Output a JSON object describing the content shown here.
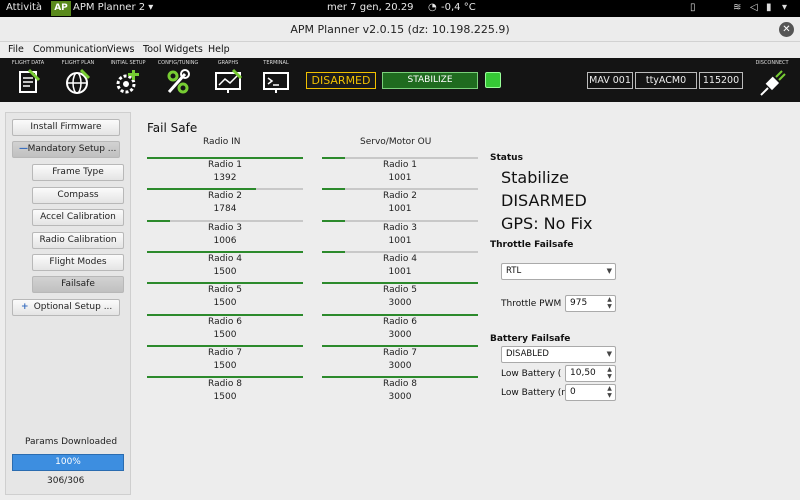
{
  "topbar": {
    "activities": "Attività",
    "app_icon_text": "AP",
    "app_name": "APM Planner 2 ▾",
    "clock": "mer  7 gen, 20.29",
    "weather": "-0,4 °C"
  },
  "window": {
    "title": "APM Planner v2.0.15 (dz: 10.198.225.9)",
    "close": "✕"
  },
  "menu": [
    "File",
    "Communication",
    "Views",
    "Tool Widgets",
    "Help"
  ],
  "toolbar": {
    "tools": [
      "FLIGHT DATA",
      "FLIGHT PLAN",
      "INITIAL SETUP",
      "CONFIG/TUNING",
      "GRAPHS",
      "TERMINAL"
    ],
    "arm_state": "DISARMED",
    "flight_mode": "STABILIZE",
    "mav": "MAV 001",
    "port": "ttyACM0",
    "baud": "115200",
    "disconnect": "DISCONNECT"
  },
  "sidebar": {
    "install_firmware": "Install Firmware",
    "mandatory_setup": "Mandatory Setup ...",
    "items": [
      "Frame Type",
      "Compass",
      "Accel Calibration",
      "Radio Calibration",
      "Flight Modes",
      "Failsafe"
    ],
    "optional_setup": "Optional Setup ...",
    "params_label": "Params Downloaded",
    "progress_text": "100%",
    "progress_fraction": 1.0,
    "params_count": "306/306"
  },
  "failsafe": {
    "title": "Fail Safe",
    "radio_header": "Radio IN",
    "servo_header": "Servo/Motor OU",
    "radio": [
      {
        "name": "Radio 1",
        "value": "1392",
        "fill": 1.0
      },
      {
        "name": "Radio 2",
        "value": "1784",
        "fill": 0.7
      },
      {
        "name": "Radio 3",
        "value": "1006",
        "fill": 0.15
      },
      {
        "name": "Radio 4",
        "value": "1500",
        "fill": 1.0
      },
      {
        "name": "Radio 5",
        "value": "1500",
        "fill": 1.0
      },
      {
        "name": "Radio 6",
        "value": "1500",
        "fill": 1.0
      },
      {
        "name": "Radio 7",
        "value": "1500",
        "fill": 1.0
      },
      {
        "name": "Radio 8",
        "value": "1500",
        "fill": 1.0
      }
    ],
    "servo": [
      {
        "name": "Radio 1",
        "value": "1001",
        "fill": 0.15
      },
      {
        "name": "Radio 2",
        "value": "1001",
        "fill": 0.15
      },
      {
        "name": "Radio 3",
        "value": "1001",
        "fill": 0.15
      },
      {
        "name": "Radio 4",
        "value": "1001",
        "fill": 0.15
      },
      {
        "name": "Radio 5",
        "value": "3000",
        "fill": 1.0
      },
      {
        "name": "Radio 6",
        "value": "3000",
        "fill": 1.0
      },
      {
        "name": "Radio 7",
        "value": "3000",
        "fill": 1.0
      },
      {
        "name": "Radio 8",
        "value": "3000",
        "fill": 1.0
      }
    ],
    "status_header": "Status",
    "status_mode": "Stabilize",
    "status_arm": "DISARMED",
    "status_gps": "GPS: No Fix",
    "throttle_header": "Throttle Failsafe",
    "throttle_action": "RTL",
    "throttle_pwm_label": "Throttle PWM",
    "throttle_pwm": "975",
    "battery_header": "Battery Failsafe",
    "battery_action": "DISABLED",
    "low_batt_label": "Low Battery (",
    "low_batt_value": "10,50",
    "low_batt_r_label": "Low Battery (r",
    "low_batt_r_value": "0"
  },
  "colors": {
    "accent_green": "#2c8a2c",
    "arm_yellow": "#f0c000",
    "progress_blue": "#3d8ee0"
  }
}
